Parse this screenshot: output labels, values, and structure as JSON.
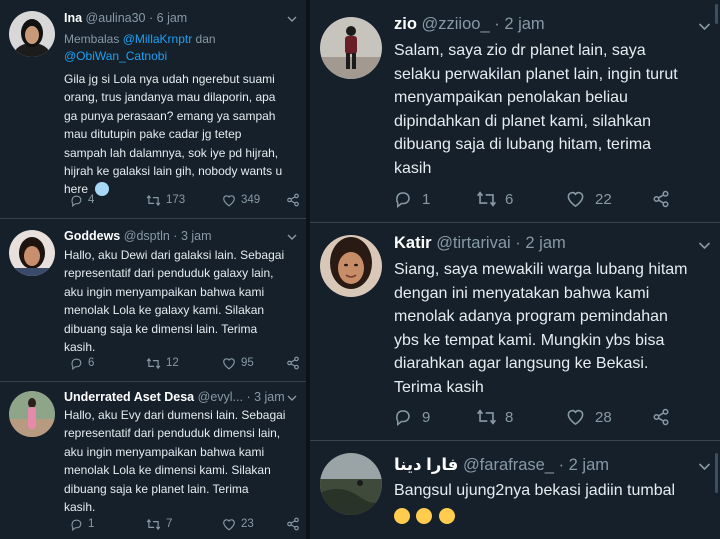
{
  "left_tweets": [
    {
      "name": "Ina",
      "handle": "@aulina30",
      "time": "6 jam",
      "reply_prefix": "Membalas ",
      "reply_mention_1": "@MillaKrnptr",
      "reply_and": " dan",
      "reply_mention_2": "@ObiWan_Catnobi",
      "lines": [
        "Gila jg si Lola nya udah ngerebut suami",
        "orang, trus jandanya mau dilaporin, apa",
        "ga punya perasaan? emang ya sampah",
        "mau ditutupin pake cadar jg tetep",
        "sampah lah dalamnya, sok iye pd hijrah,",
        "hijrah ke galaksi lain gih, nobody wants u",
        "here"
      ],
      "replies": "4",
      "retweets": "173",
      "likes": "349"
    },
    {
      "name": "Goddews",
      "handle": "@dsptln",
      "time": "3 jam",
      "lines": [
        "Hallo, aku Dewi dari galaksi lain. Sebagai",
        "representatif dari penduduk galaxy lain,",
        "aku ingin menyampaikan bahwa kami",
        "menolak Lola ke galaxy kami. Silakan",
        "dibuang saja ke dimensi lain. Terima",
        "kasih."
      ],
      "replies": "6",
      "retweets": "12",
      "likes": "95"
    },
    {
      "name": "Underrated Aset Desa",
      "handle": "@evyl...",
      "time": "3 jam",
      "lines": [
        "Hallo, aku Evy dari dumensi lain. Sebagai",
        "representatif dari penduduk dimensi lain,",
        "aku ingin menyampaikan bahwa kami",
        "menolak Lola ke dimensi kami. Silakan",
        "dibuang saja ke planet lain. Terima",
        "kasih."
      ],
      "replies": "1",
      "retweets": "7",
      "likes": "23"
    }
  ],
  "right_tweets": [
    {
      "name": "zio",
      "handle": "@zziioo_",
      "time": "2 jam",
      "lines": [
        "Salam, saya zio dr planet lain, saya",
        "selaku perwakilan planet lain, ingin turut",
        "menyampaikan penolakan beliau",
        "dipindahkan di planet kami, silahkan",
        "dibuang saja di lubang hitam, terima",
        "kasih"
      ],
      "replies": "1",
      "retweets": "6",
      "likes": "22"
    },
    {
      "name": "Katir",
      "handle": "@tirtarivai",
      "time": "2 jam",
      "lines": [
        "Siang, saya mewakili warga lubang hitam",
        "dengan ini menyatakan bahwa kami",
        "menolak adanya program pemindahan",
        "ybs ke tempat kami. Mungkin ybs bisa",
        "diarahkan agar langsung ke Bekasi.",
        "Terima kasih"
      ],
      "replies": "9",
      "retweets": "8",
      "likes": "28"
    },
    {
      "name": "فارا دينا",
      "handle": "@farafrase_",
      "time": "2 jam",
      "lines": [
        "Bangsul ujung2nya bekasi jadiin tumbal"
      ]
    }
  ],
  "icons": {
    "reply": "reply-icon",
    "retweet": "retweet-icon",
    "like": "heart-icon",
    "share": "share-icon",
    "chevron": "chevron-down-icon"
  },
  "colors": {
    "background": "#15202b",
    "mention": "#1da1f2",
    "secondary_text": "#8899a6"
  }
}
